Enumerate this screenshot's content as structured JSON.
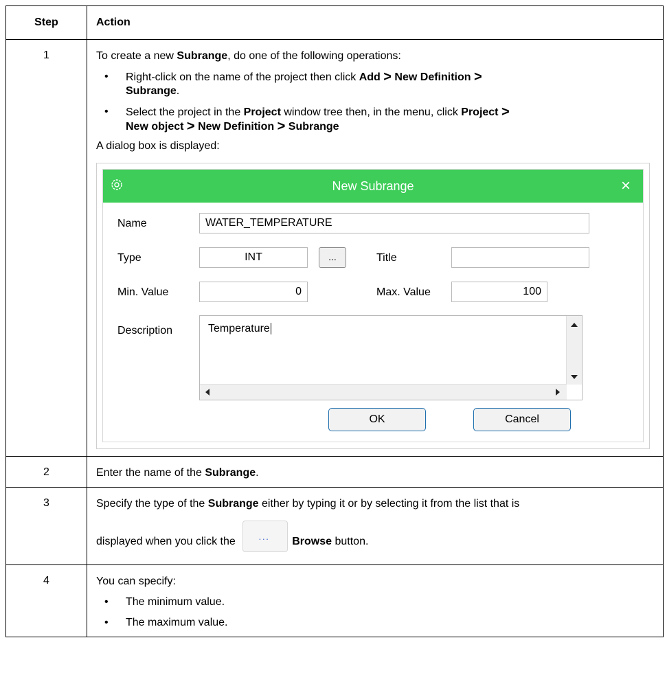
{
  "table": {
    "header_step": "Step",
    "header_action": "Action",
    "rows": [
      {
        "step": "1"
      },
      {
        "step": "2"
      },
      {
        "step": "3"
      },
      {
        "step": "4"
      }
    ]
  },
  "row1": {
    "intro_pre": "To create a new ",
    "intro_bold": "Subrange",
    "intro_post": ", do one of the following operations:",
    "b1_pre": "Right-click on the name of the project then click ",
    "b1_add": "Add",
    "b1_newdef": "New Definition",
    "b1_sub": "Subrange",
    "b1_end": ".",
    "b2_pre": "Select the project in the ",
    "b2_project": "Project",
    "b2_mid": " window tree then, in the menu, click ",
    "b2_project2": "Project",
    "b2_newobj": "New object",
    "b2_newdef": "New Definition",
    "b2_sub": "Subrange",
    "arrow": ">",
    "dialog_note": "A dialog box is displayed:"
  },
  "dialog": {
    "title": "New Subrange",
    "close": "×",
    "name_label": "Name",
    "name_value": "WATER_TEMPERATURE",
    "type_label": "Type",
    "type_value": "INT",
    "browse_label": "...",
    "title_label": "Title",
    "title_value": "",
    "min_label": "Min. Value",
    "min_value": "0",
    "max_label": "Max. Value",
    "max_value": "100",
    "desc_label": "Description",
    "desc_value": "Temperature",
    "ok": "OK",
    "cancel": "Cancel",
    "accent": "#3dcd58"
  },
  "row2": {
    "pre": "Enter the name of the ",
    "bold": "Subrange",
    "post": "."
  },
  "row3": {
    "pre": "Specify the type of the ",
    "bold": "Subrange",
    "post": " either by typing it or by selecting it from the list that is",
    "line2_pre": "displayed when you click the ",
    "browse": "Browse",
    "line2_post": " button."
  },
  "row4": {
    "intro": "You can specify:",
    "items": [
      "The minimum value.",
      "The maximum value."
    ]
  }
}
